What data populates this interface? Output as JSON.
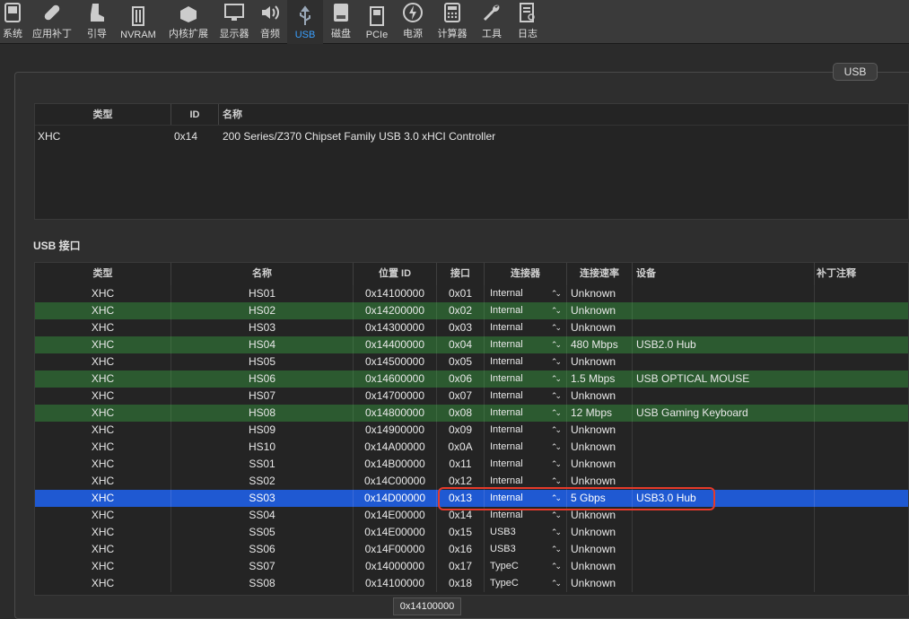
{
  "toolbar": {
    "items": [
      {
        "label": "系统",
        "icon": "monitor-tower-icon"
      },
      {
        "label": "应用补丁",
        "icon": "bandage-icon"
      },
      {
        "label": "引导",
        "icon": "boot-icon"
      },
      {
        "label": "NVRAM",
        "icon": "nvram-chip-icon"
      },
      {
        "label": "内核扩展",
        "icon": "lego-brick-icon"
      },
      {
        "label": "显示器",
        "icon": "display-icon"
      },
      {
        "label": "音频",
        "icon": "speaker-icon"
      },
      {
        "label": "USB",
        "icon": "usb-icon"
      },
      {
        "label": "磁盘",
        "icon": "disk-icon"
      },
      {
        "label": "PCIe",
        "icon": "pcie-card-icon"
      },
      {
        "label": "电源",
        "icon": "power-icon"
      },
      {
        "label": "计算器",
        "icon": "calculator-icon"
      },
      {
        "label": "工具",
        "icon": "wrench-icon"
      },
      {
        "label": "日志",
        "icon": "log-icon"
      }
    ]
  },
  "tab": {
    "label": "USB"
  },
  "controllers": {
    "headers": {
      "type": "类型",
      "id": "ID",
      "name": "名称"
    },
    "rows": [
      {
        "type": "XHC",
        "id": "0x14",
        "name": "200 Series/Z370 Chipset Family USB 3.0 xHCI Controller"
      }
    ]
  },
  "ports_section": {
    "label": "USB 接口"
  },
  "ports": {
    "headers": {
      "type": "类型",
      "name": "名称",
      "location": "位置 ID",
      "port": "接口",
      "connector": "连接器",
      "speed": "连接速率",
      "device": "设备",
      "note": "补丁注释"
    },
    "rows": [
      {
        "type": "XHC",
        "name": "HS01",
        "location": "0x14100000",
        "port": "0x01",
        "connector": "Internal",
        "speed": "Unknown",
        "device": "",
        "style": "plain"
      },
      {
        "type": "XHC",
        "name": "HS02",
        "location": "0x14200000",
        "port": "0x02",
        "connector": "Internal",
        "speed": "Unknown",
        "device": "",
        "style": "green"
      },
      {
        "type": "XHC",
        "name": "HS03",
        "location": "0x14300000",
        "port": "0x03",
        "connector": "Internal",
        "speed": "Unknown",
        "device": "",
        "style": "plain"
      },
      {
        "type": "XHC",
        "name": "HS04",
        "location": "0x14400000",
        "port": "0x04",
        "connector": "Internal",
        "speed": "480 Mbps",
        "device": "USB2.0 Hub",
        "style": "green"
      },
      {
        "type": "XHC",
        "name": "HS05",
        "location": "0x14500000",
        "port": "0x05",
        "connector": "Internal",
        "speed": "Unknown",
        "device": "",
        "style": "plain"
      },
      {
        "type": "XHC",
        "name": "HS06",
        "location": "0x14600000",
        "port": "0x06",
        "connector": "Internal",
        "speed": "1.5 Mbps",
        "device": "USB OPTICAL MOUSE",
        "style": "green"
      },
      {
        "type": "XHC",
        "name": "HS07",
        "location": "0x14700000",
        "port": "0x07",
        "connector": "Internal",
        "speed": "Unknown",
        "device": "",
        "style": "plain"
      },
      {
        "type": "XHC",
        "name": "HS08",
        "location": "0x14800000",
        "port": "0x08",
        "connector": "Internal",
        "speed": "12 Mbps",
        "device": "USB Gaming Keyboard",
        "style": "green"
      },
      {
        "type": "XHC",
        "name": "HS09",
        "location": "0x14900000",
        "port": "0x09",
        "connector": "Internal",
        "speed": "Unknown",
        "device": "",
        "style": "plain"
      },
      {
        "type": "XHC",
        "name": "HS10",
        "location": "0x14A00000",
        "port": "0x0A",
        "connector": "Internal",
        "speed": "Unknown",
        "device": "",
        "style": "plain"
      },
      {
        "type": "XHC",
        "name": "SS01",
        "location": "0x14B00000",
        "port": "0x11",
        "connector": "Internal",
        "speed": "Unknown",
        "device": "",
        "style": "plain"
      },
      {
        "type": "XHC",
        "name": "SS02",
        "location": "0x14C00000",
        "port": "0x12",
        "connector": "Internal",
        "speed": "Unknown",
        "device": "",
        "style": "plain"
      },
      {
        "type": "XHC",
        "name": "SS03",
        "location": "0x14D00000",
        "port": "0x13",
        "connector": "Internal",
        "speed": "5 Gbps",
        "device": "USB3.0 Hub",
        "style": "selected"
      },
      {
        "type": "XHC",
        "name": "SS04",
        "location": "0x14E00000",
        "port": "0x14",
        "connector": "Internal",
        "speed": "Unknown",
        "device": "",
        "style": "plain"
      },
      {
        "type": "XHC",
        "name": "SS05",
        "location": "0x14E00000",
        "port": "0x15",
        "connector": "USB3",
        "speed": "Unknown",
        "device": "",
        "style": "plain"
      },
      {
        "type": "XHC",
        "name": "SS06",
        "location": "0x14F00000",
        "port": "0x16",
        "connector": "USB3",
        "speed": "Unknown",
        "device": "",
        "style": "plain"
      },
      {
        "type": "XHC",
        "name": "SS07",
        "location": "0x14000000",
        "port": "0x17",
        "connector": "TypeC",
        "speed": "Unknown",
        "device": "",
        "style": "plain"
      },
      {
        "type": "XHC",
        "name": "SS08",
        "location": "0x14100000",
        "port": "0x18",
        "connector": "TypeC",
        "speed": "Unknown",
        "device": "",
        "style": "plain"
      }
    ]
  },
  "tooltip": {
    "text": "0x14100000"
  },
  "colors": {
    "accent": "#3aa0ff",
    "selected_row": "#1f59d2",
    "active_row": "#2c5a30",
    "highlight_box": "#e53a2a"
  }
}
